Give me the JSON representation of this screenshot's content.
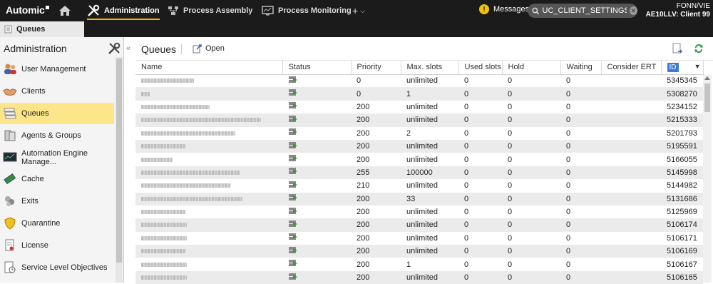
{
  "app": {
    "logo": "Automic"
  },
  "nav": {
    "home_label": "",
    "administration": "Administration",
    "process_assembly": "Process Assembly",
    "process_monitoring": "Process Monitoring",
    "add": "+"
  },
  "top": {
    "messages": "Messages",
    "search_value": "UC_CLIENT_SETTINGS",
    "user": "FONN/VIE",
    "client": "AE10LLV: Client 99"
  },
  "tab": {
    "label": "Queues"
  },
  "sidebar": {
    "title": "Administration",
    "items": [
      {
        "label": "User Management",
        "icon": "users-icon"
      },
      {
        "label": "Clients",
        "icon": "handshake-icon"
      },
      {
        "label": "Queues",
        "icon": "queues-icon",
        "active": true
      },
      {
        "label": "Agents & Groups",
        "icon": "agents-icon"
      },
      {
        "label": "Automation Engine Manage...",
        "icon": "engine-monitor-icon"
      },
      {
        "label": "Cache",
        "icon": "memory-icon"
      },
      {
        "label": "Exits",
        "icon": "exits-icon"
      },
      {
        "label": "Quarantine",
        "icon": "shield-icon"
      },
      {
        "label": "License",
        "icon": "license-icon"
      },
      {
        "label": "Service Level Objectives",
        "icon": "slo-icon"
      }
    ]
  },
  "main": {
    "title": "Queues",
    "open_label": "Open",
    "columns": [
      "Name",
      "Status",
      "Priority",
      "Max. slots",
      "Used slots",
      "Hold",
      "Waiting",
      "Consider ERT",
      "ID"
    ],
    "rows": [
      {
        "priority": "0",
        "max": "unlimited",
        "used": "0",
        "hold": "0",
        "waiting": "0",
        "id": "5345345"
      },
      {
        "priority": "0",
        "max": "1",
        "used": "0",
        "hold": "0",
        "waiting": "0",
        "id": "5308270"
      },
      {
        "priority": "200",
        "max": "unlimited",
        "used": "0",
        "hold": "0",
        "waiting": "0",
        "id": "5234152"
      },
      {
        "priority": "200",
        "max": "unlimited",
        "used": "0",
        "hold": "0",
        "waiting": "0",
        "id": "5215333"
      },
      {
        "priority": "200",
        "max": "2",
        "used": "0",
        "hold": "0",
        "waiting": "0",
        "id": "5201793"
      },
      {
        "priority": "200",
        "max": "unlimited",
        "used": "0",
        "hold": "0",
        "waiting": "0",
        "id": "5195591"
      },
      {
        "priority": "200",
        "max": "unlimited",
        "used": "0",
        "hold": "0",
        "waiting": "0",
        "id": "5166055"
      },
      {
        "priority": "255",
        "max": "100000",
        "used": "0",
        "hold": "0",
        "waiting": "0",
        "id": "5145998"
      },
      {
        "priority": "210",
        "max": "unlimited",
        "used": "0",
        "hold": "0",
        "waiting": "0",
        "id": "5144982"
      },
      {
        "priority": "200",
        "max": "33",
        "used": "0",
        "hold": "0",
        "waiting": "0",
        "id": "5131686"
      },
      {
        "priority": "200",
        "max": "unlimited",
        "used": "0",
        "hold": "0",
        "waiting": "0",
        "id": "5125969"
      },
      {
        "priority": "200",
        "max": "unlimited",
        "used": "0",
        "hold": "0",
        "waiting": "0",
        "id": "5106174"
      },
      {
        "priority": "200",
        "max": "unlimited",
        "used": "0",
        "hold": "0",
        "waiting": "0",
        "id": "5106171"
      },
      {
        "priority": "200",
        "max": "unlimited",
        "used": "0",
        "hold": "0",
        "waiting": "0",
        "id": "5106169"
      },
      {
        "priority": "200",
        "max": "1",
        "used": "0",
        "hold": "0",
        "waiting": "0",
        "id": "5106167"
      },
      {
        "priority": "200",
        "max": "unlimited",
        "used": "0",
        "hold": "0",
        "waiting": "0",
        "id": "5106165"
      }
    ]
  },
  "colors": {
    "topbar": "#1b1b1b",
    "accent": "#f5b400",
    "active_item": "#fde58a",
    "id_header": "#3e7bd7",
    "status_green": "#3c9a3c"
  }
}
